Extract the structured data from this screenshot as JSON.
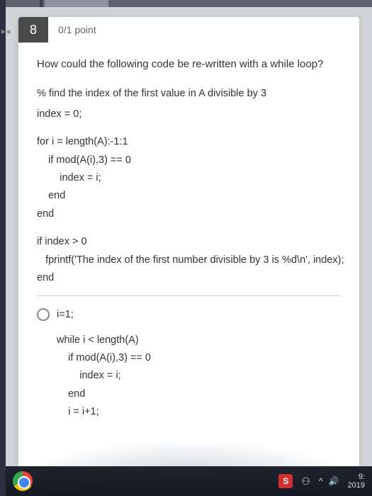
{
  "question": {
    "number": "8",
    "points": "0/1 point",
    "prompt": "How could the following code be re-written with a while loop?",
    "code_comment": "% find the index of the first value in A divisible by 3",
    "code_line1": "index = 0;",
    "code_block2": "for i = length(A):-1:1\n    if mod(A(i),3) == 0\n        index = i;\n    end\nend",
    "code_block3": "if index > 0\n   fprintf('The index of the first number divisible by 3 is %d\\n', index);\nend"
  },
  "answer": {
    "label": "i=1;",
    "code": "while i < length(A)\n    if mod(A(i),3) == 0\n        index = i;\n    end\n    i = i+1;"
  },
  "taskbar": {
    "s_label": "S",
    "people": "⚇",
    "chevron": "^",
    "sound": "🔊",
    "time_top": "9:",
    "time_bottom": "2019"
  }
}
